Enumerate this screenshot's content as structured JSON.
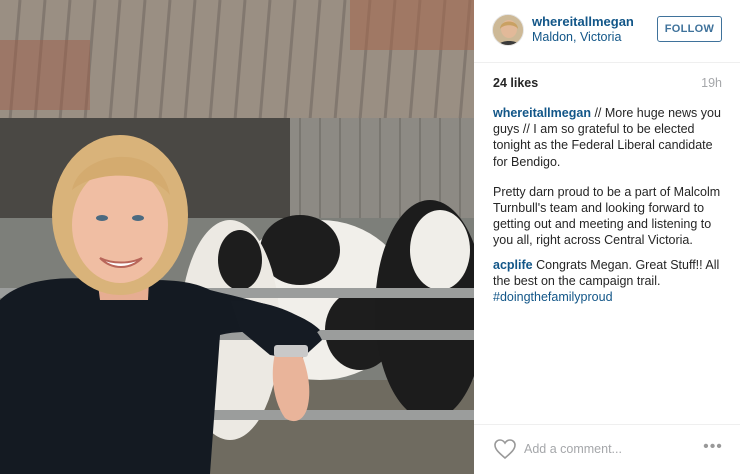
{
  "post": {
    "photo_alt": "",
    "author": {
      "username": "whereitallmegan",
      "location": "Maldon, Victoria",
      "avatar_icon": "profile-avatar"
    },
    "follow_label": "FOLLOW",
    "likes": "24 likes",
    "time_ago": "19h",
    "caption": {
      "username": "whereitallmegan",
      "paragraph_1": "// More huge news you guys // I am so grateful to be elected tonight as the Federal Liberal candidate for Bendigo.",
      "paragraph_2": "Pretty darn proud to be a part of Malcolm Turnbull's team and looking forward to getting out and meeting and listening to you all, right across Central Victoria."
    },
    "comments": [
      {
        "username": "acplife",
        "text": "Congrats Megan. Great Stuff!! All the best on the campaign trail.",
        "hashtag": "#doingthefamilyproud"
      }
    ],
    "add_comment_placeholder": "Add a comment...",
    "icons": {
      "like": "heart-icon",
      "more": "more-options-icon"
    },
    "colors": {
      "link": "#125688",
      "follow": "#3f729b",
      "muted": "#a5a7aa"
    }
  }
}
